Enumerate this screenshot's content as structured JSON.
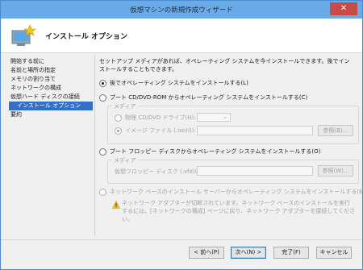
{
  "window": {
    "title": "仮想マシンの新規作成ウィザード",
    "close_symbol": "✕"
  },
  "header": {
    "title": "インストール オプション"
  },
  "nav": {
    "items": [
      {
        "label": "開始する前に"
      },
      {
        "label": "名前と場所の指定"
      },
      {
        "label": "メモリの割り当て"
      },
      {
        "label": "ネットワークの構成"
      },
      {
        "label": "仮想ハード ディスクの接続"
      },
      {
        "label": "インストール オプション"
      },
      {
        "label": "要約"
      }
    ]
  },
  "content": {
    "intro": "セットアップ メディアがあれば、オペレーティング システムを今インストールできます。後でインストールすることもできます。",
    "opt_later": "後でオペレーティング システムをインストールする(L)",
    "opt_cd": "ブート CD/DVD-ROM からオペレーティング システムをインストールする(C)",
    "media_label": "メディア",
    "physical_drive": "物理 CD/DVD ドライブ(H):",
    "image_file": "イメージ ファイル (.iso)(I):",
    "browse1": "参照(B)...",
    "opt_floppy": "ブート フロッピー ディスクからオペレーティング システムをインストールする(O)",
    "media_label2": "メディア",
    "vfd": "仮想フロッピー ディスク (.vfd)(V):",
    "browse2": "参照(W)...",
    "opt_network": "ネットワーク ベースのインストール サーバーからオペレーティング システムをインストールする(E)",
    "network_warning": "ネットワーク アダプターが切断されています。ネットワーク ベースのインストールを実行するには、[ネットワークの構成] ページに戻り、ネットワーク アダプターを接続してください。"
  },
  "buttons": {
    "back": "< 前へ(P)",
    "next": "次へ(N) >",
    "finish": "完了(F)",
    "cancel": "キャンセル"
  },
  "colors": {
    "selected_nav": "#3070c8",
    "titlebar": "#6aaae6",
    "close": "#c94a46"
  }
}
